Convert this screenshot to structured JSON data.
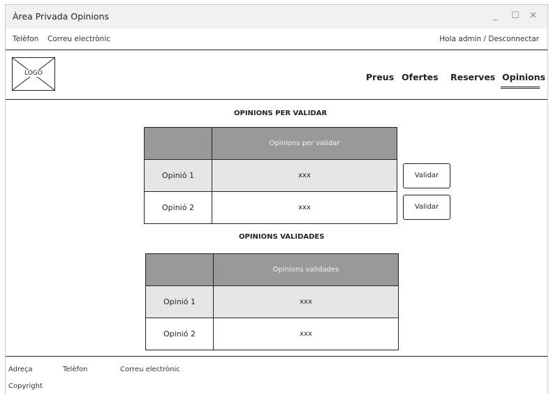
{
  "window": {
    "title": "Àrea Privada Opinions",
    "minimize": "_",
    "maximize": "☐",
    "close": "✕"
  },
  "topbar": {
    "phone": "Telèfon",
    "email": "Correu electrònic",
    "user": "Hola admin / Desconnectar"
  },
  "header": {
    "logo": "LOGO",
    "nav": [
      "Preus",
      "Ofertes",
      "Reserves",
      "Opinions"
    ],
    "active_nav": "Opinions"
  },
  "pending": {
    "title": "OPINIONS PER VALIDAR",
    "header": "Opinions per validar",
    "rows": [
      {
        "label": "Opinió 1",
        "value": "xxx",
        "button": "Validar"
      },
      {
        "label": "Opinió 2",
        "value": "xxx",
        "button": "Validar"
      }
    ]
  },
  "validated": {
    "title": "OPINIONS VALIDADES",
    "header": "Opinions validades",
    "rows": [
      {
        "label": "Opinió 1",
        "value": "xxx"
      },
      {
        "label": "Opinió 2",
        "value": "xxx"
      }
    ]
  },
  "footer": {
    "address": "Adreça",
    "phone": "Telèfon",
    "email": "Correu electrònic",
    "copyright": "Copyright"
  },
  "colors": {
    "table_header": "#999999",
    "row_shade": "#e6e6e6",
    "titlebar": "#f1f1f1"
  }
}
